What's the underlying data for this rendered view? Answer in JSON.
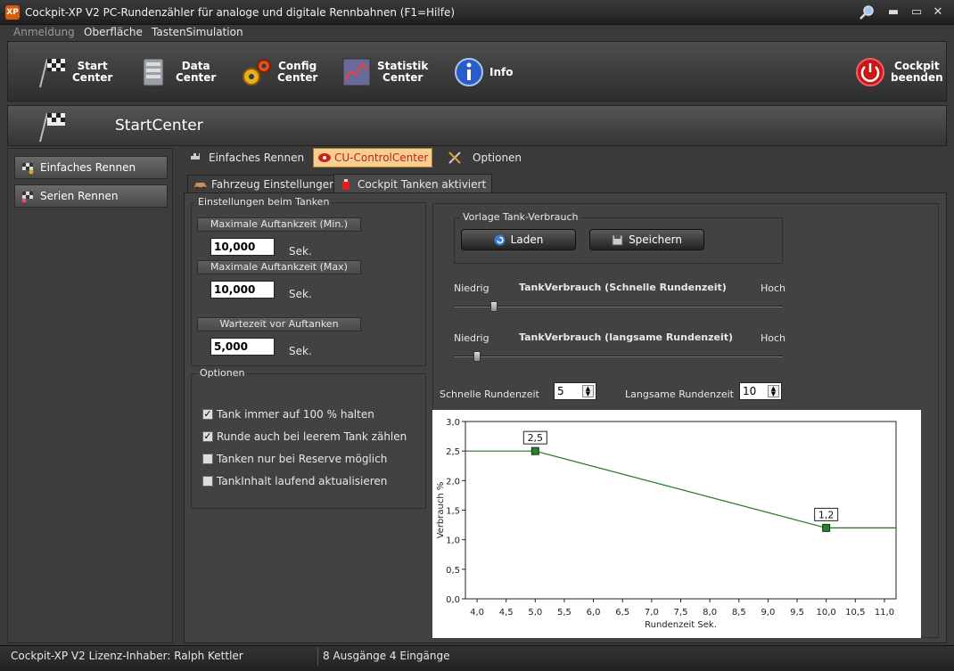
{
  "window": {
    "title": "Cockpit-XP V2 PC-Rundenzähler für analoge und digitale Rennbahnen (F1=Hilfe)",
    "app_icon_text": "XP"
  },
  "menu": {
    "items": [
      "Anmeldung",
      "Oberfläche",
      "TastenSimulation"
    ]
  },
  "toolbar": {
    "start": "Start\nCenter",
    "data": "Data\nCenter",
    "config": "Config\nCenter",
    "statistik": "Statistik\nCenter",
    "info": "Info",
    "quit": "Cockpit\nbeenden"
  },
  "header": {
    "title": "StartCenter"
  },
  "sidebar": {
    "items": [
      "Einfaches Rennen",
      "Serien Rennen"
    ]
  },
  "tabs": {
    "items": [
      "Einfaches Rennen",
      "CU-ControlCenter",
      "Optionen"
    ],
    "active": 1
  },
  "subtabs": {
    "items": [
      "Fahrzeug Einstellungen",
      "Cockpit Tanken aktiviert"
    ],
    "active": 1
  },
  "tanken": {
    "group_label": "Einstellungen beim Tanken",
    "max_min_label": "Maximale Auftankzeit (Min.)",
    "max_min_value": "10,000",
    "max_max_label": "Maximale Auftankzeit (Max)",
    "max_max_value": "10,000",
    "wait_label": "Wartezeit vor Auftanken",
    "wait_value": "5,000",
    "unit": "Sek."
  },
  "options": {
    "group_label": "Optionen",
    "items": [
      {
        "label": "Tank immer auf 100 % halten",
        "checked": true
      },
      {
        "label": "Runde auch bei leerem Tank zählen",
        "checked": true
      },
      {
        "label": "Tanken nur bei Reserve möglich",
        "checked": false
      },
      {
        "label": "TankInhalt laufend aktualisieren",
        "checked": false
      }
    ]
  },
  "vorlage": {
    "group_label": "Vorlage Tank-Verbrauch",
    "load": "Laden",
    "save": "Speichern"
  },
  "slider1": {
    "low": "Niedrig",
    "title": "TankVerbrauch (Schnelle Rundenzeit)",
    "high": "Hoch",
    "value": 0.11
  },
  "slider2": {
    "low": "Niedrig",
    "title": "TankVerbrauch (langsame Rundenzeit)",
    "high": "Hoch",
    "value": 0.06
  },
  "rundenzeit": {
    "fast_label": "Schnelle Rundenzeit",
    "fast_value": "5",
    "slow_label": "Langsame Rundenzeit",
    "slow_value": "10"
  },
  "chart_data": {
    "type": "line",
    "xlabel": "Rundenzeit Sek.",
    "ylabel": "Verbrauch %",
    "xlim": [
      3.8,
      11.2
    ],
    "ylim": [
      0,
      3.0
    ],
    "xticks": [
      "4,0",
      "4,5",
      "5,0",
      "5,5",
      "6,0",
      "6,5",
      "7,0",
      "7,5",
      "8,0",
      "8,5",
      "9,0",
      "9,5",
      "10,0",
      "10,5",
      "11,0"
    ],
    "yticks": [
      "0,0",
      "0,5",
      "1,0",
      "1,5",
      "2,0",
      "2,5",
      "3,0"
    ],
    "series": [
      {
        "x": [
          3.8,
          5.0,
          10.0,
          11.2
        ],
        "y": [
          2.5,
          2.5,
          1.2,
          1.2
        ]
      }
    ],
    "points": [
      {
        "x": 5.0,
        "y": 2.5,
        "label": "2,5"
      },
      {
        "x": 10.0,
        "y": 1.2,
        "label": "1,2"
      }
    ],
    "grid": false
  },
  "status": {
    "license": "Cockpit-XP V2 Lizenz-Inhaber: Ralph Kettler",
    "io": "8 Ausgänge 4 Eingänge"
  }
}
